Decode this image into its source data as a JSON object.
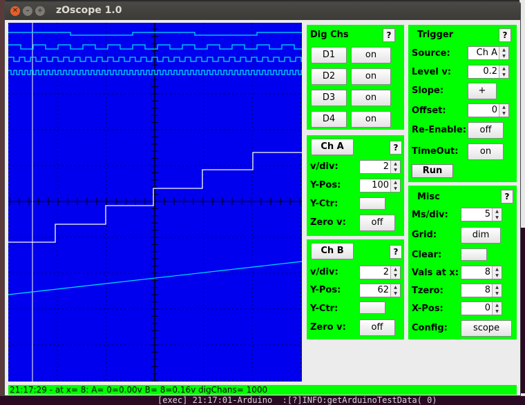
{
  "window": {
    "title": "zOscope 1.0"
  },
  "terminal_line": "[exec] 21:17:01-Arduino  :[?]INFO:getArduinoTestData( 0)",
  "dig_chs": {
    "title": "Dig Chs",
    "help": "?",
    "channels": [
      {
        "name": "D1",
        "state": "on"
      },
      {
        "name": "D2",
        "state": "on"
      },
      {
        "name": "D3",
        "state": "on"
      },
      {
        "name": "D4",
        "state": "on"
      }
    ]
  },
  "ch_a": {
    "title": "Ch A",
    "help": "?",
    "vdiv_label": "v/div:",
    "vdiv": "2",
    "ypos_label": "Y-Pos:",
    "ypos": "100",
    "yctr_label": "Y-Ctr:",
    "zerov_label": "Zero v:",
    "zerov": "off"
  },
  "ch_b": {
    "title": "Ch B",
    "help": "?",
    "vdiv_label": "v/div:",
    "vdiv": "2",
    "ypos_label": "Y-Pos:",
    "ypos": "62",
    "yctr_label": "Y-Ctr:",
    "zerov_label": "Zero v:",
    "zerov": "off"
  },
  "trigger": {
    "title": "Trigger",
    "help": "?",
    "source_label": "Source:",
    "source": "Ch A",
    "level_label": "Level v:",
    "level": "0.2",
    "slope_label": "Slope:",
    "slope": "+",
    "offset_label": "Offset:",
    "offset": "0",
    "reenable_label": "Re-Enable:",
    "reenable": "off",
    "timeout_label": "TimeOut:",
    "timeout": "on",
    "run": "Run"
  },
  "misc": {
    "title": "Misc",
    "help": "?",
    "msdiv_label": "Ms/div:",
    "msdiv": "5",
    "grid_label": "Grid:",
    "grid": "dim",
    "clear_label": "Clear:",
    "vals_label": "Vals at x:",
    "vals": "8",
    "tzero_label": "Tzero:",
    "tzero": "8",
    "xpos_label": "X-Pos:",
    "xpos": "0",
    "config_label": "Config:",
    "config": "scope"
  },
  "status": "21:17:29 - at x= 8:  A= 0=0.00v  B= 8=0.16v  digChans= 1000",
  "colors": {
    "scope_bg": "#0000ee",
    "panel": "#00ff00",
    "trace_a": "#ffffff",
    "trace_b": "#00e6ff",
    "digital": "#00e6ff"
  }
}
